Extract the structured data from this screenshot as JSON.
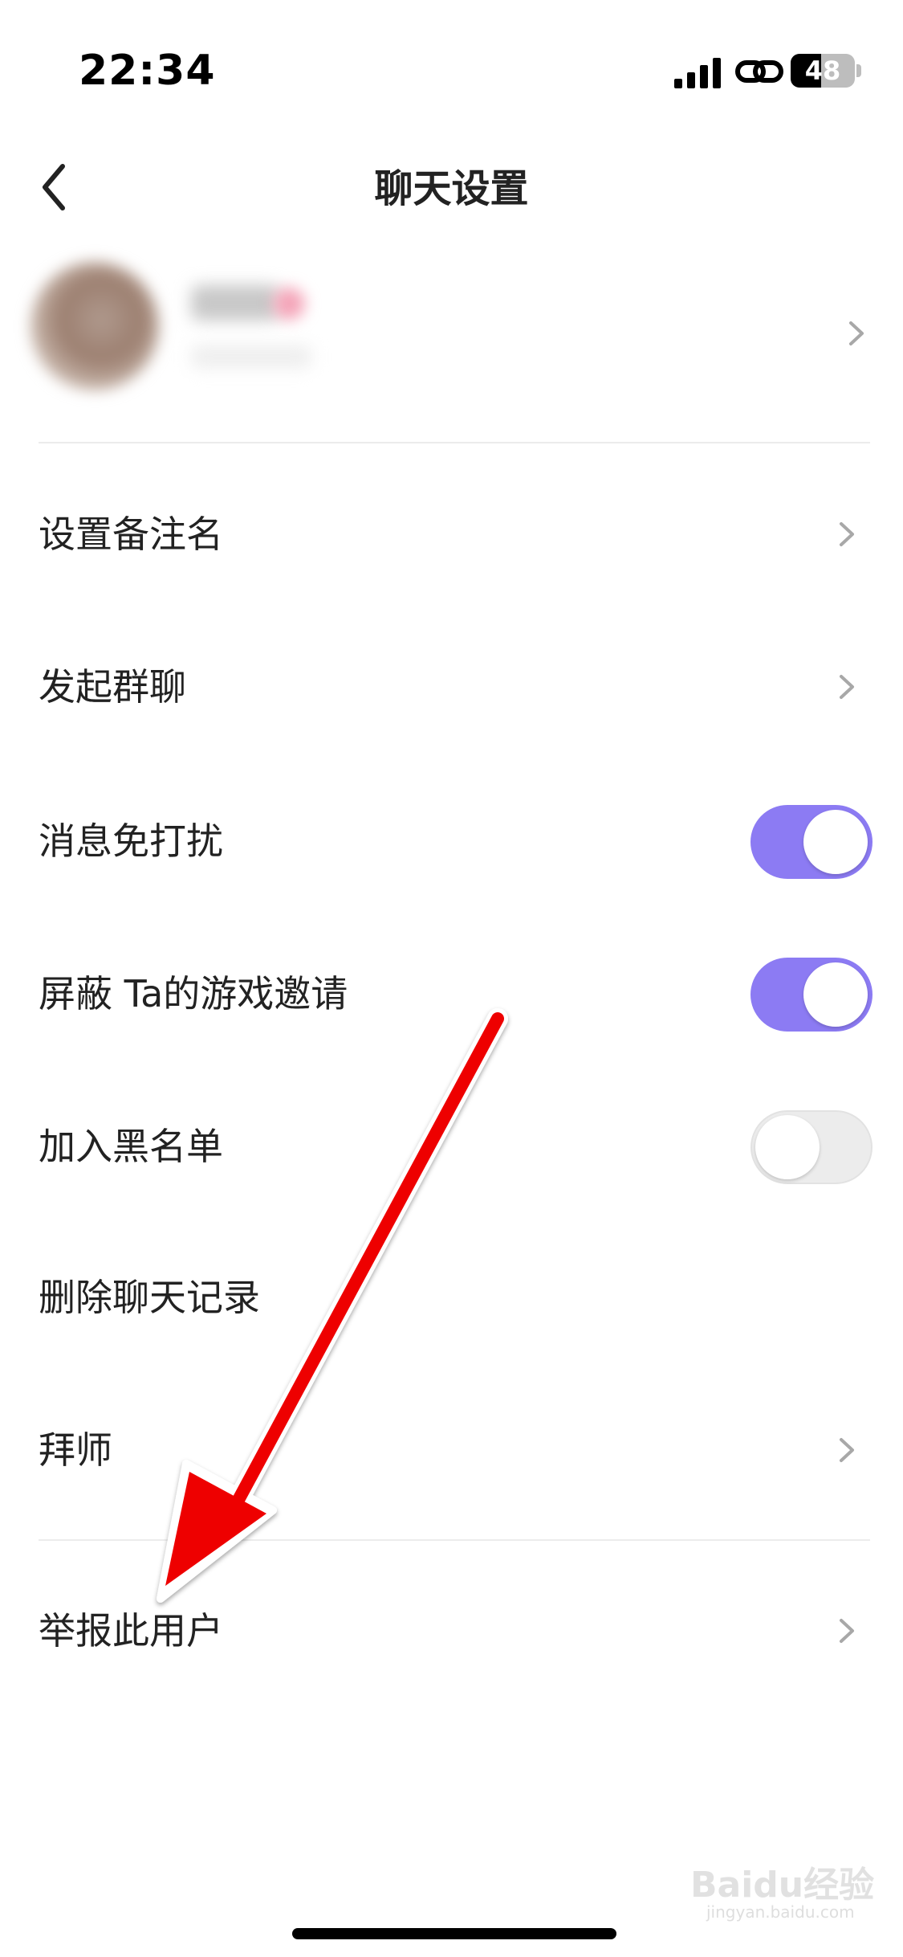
{
  "status_bar": {
    "time": "22:34",
    "battery": "48",
    "battery_level": 0.48
  },
  "header": {
    "title": "聊天设置",
    "back_icon": "chevron-left-icon"
  },
  "settings": {
    "remark": {
      "label": "设置备注名"
    },
    "group_chat": {
      "label": "发起群聊"
    },
    "do_not_disturb": {
      "label": "消息免打扰",
      "enabled": true
    },
    "block_game_invites": {
      "label": "屏蔽 Ta的游戏邀请",
      "enabled": true
    },
    "blacklist": {
      "label": "加入黑名单",
      "enabled": false
    },
    "delete_history": {
      "label": "删除聊天记录"
    },
    "apprentice": {
      "label": "拜师"
    },
    "report_user": {
      "label": "举报此用户"
    }
  },
  "watermark": {
    "text": "Baidu经验",
    "sub": "jingyan.baidu.com"
  },
  "colors": {
    "toggle_on": "#8c7bf3",
    "toggle_off": "#ececec",
    "annotation_arrow": "#ee0000"
  }
}
